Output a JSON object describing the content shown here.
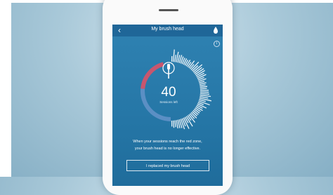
{
  "app": {
    "title": "My brush head",
    "back_icon": "chevron-left-icon",
    "action_icon": "drop-icon",
    "info_icon": "info-icon"
  },
  "gauge": {
    "remaining": "40",
    "remaining_label": "Sessions left",
    "remaining_fraction": 0.5,
    "colors": {
      "remaining": "#ffffff",
      "used": "#5b8fc4",
      "red_zone": "#c8566e"
    }
  },
  "message": {
    "line1": "When your sessions reach the red zone,",
    "line2": "your brush head is no longer effective."
  },
  "button": {
    "label": "I replaced my brush head"
  }
}
